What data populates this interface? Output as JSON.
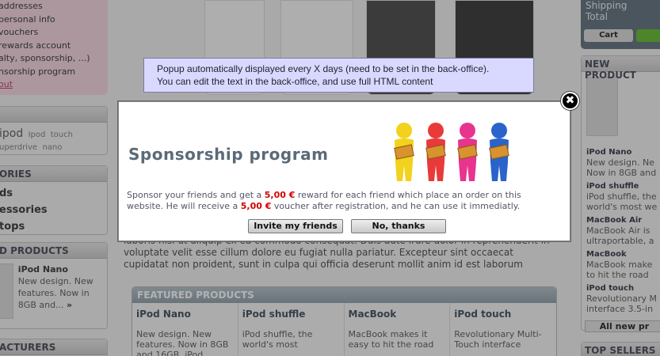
{
  "left": {
    "account_links": [
      "addresses",
      "personal info",
      "vouchers",
      "rewards account",
      "alty, sponsorship, ...)",
      "nsorship program"
    ],
    "logout": "out",
    "tags": {
      "big": "ipod",
      "items": [
        "Ipod",
        "touch",
        "uperdrive",
        "nano"
      ]
    },
    "categories_head": "ORIES",
    "categories": [
      "ds",
      "essories",
      "tops"
    ],
    "new_products_head": "D PRODUCTS",
    "new_product": {
      "name": "iPod Nano",
      "desc": "New design. New features. Now in 8GB and...",
      "more": "»"
    },
    "manufacturers_head": "ACTURERS"
  },
  "center": {
    "lorem": "laboris nisi ut aliquip ex ea commodo consequat. Duis aute irure dolor in reprehenderit in voluptate velit esse cillum dolore eu fugiat nulla pariatur. Excepteur sint occaecat cupidatat non proident, sunt in culpa qui officia deserunt mollit anim id est laborum",
    "featured_head": "FEATURED PRODUCTS",
    "featured": [
      {
        "name": "iPod Nano",
        "desc": "New design. New features. Now in 8GB and 16GB. iPod"
      },
      {
        "name": "iPod shuffle",
        "desc": "iPod shuffle, the world's most"
      },
      {
        "name": "MacBook",
        "desc": "MacBook makes it easy to hit the road"
      },
      {
        "name": "iPod touch",
        "desc": "Revolutionary Multi-Touch interface"
      }
    ]
  },
  "right": {
    "cart_lines": [
      "Shipping",
      "Total"
    ],
    "cart_button": "Cart",
    "new_products_head": "NEW PRODUCT",
    "items": [
      {
        "name": "iPod Nano",
        "desc": "New design. Ne Now in 8GB and"
      },
      {
        "name": "iPod shuffle",
        "desc": "iPod shuffle, the world's most we"
      },
      {
        "name": "MacBook Air",
        "desc": "MacBook Air is ultraportable, a"
      },
      {
        "name": "MacBook",
        "desc": "MacBook make to hit the road"
      },
      {
        "name": "iPod touch",
        "desc": "Revolutionary M interface 3.5-in"
      }
    ],
    "all_new": "All new pr",
    "top_sellers_head": "TOP SELLERS"
  },
  "tooltip": {
    "line1": "Popup automatically displayed every X days (need to be set in the back-office).",
    "line2": "You can edit the text in the back-office, and use full HTML content"
  },
  "popup": {
    "title": "Sponsorship program",
    "text_1": "Sponsor your friends and get a ",
    "amount_1": "5,00 €",
    "text_2": " reward for each friend which place an order on this website. He will receive a ",
    "amount_2": "5,00 €",
    "text_3": " voucher after registration, and he can use it immediatly.",
    "invite_button": "Invite my friends",
    "no_thanks_button": "No, thanks",
    "close_glyph": "✖",
    "figure_colors": [
      "#f2d21b",
      "#e83a3a",
      "#e8338f",
      "#2a63c9"
    ]
  }
}
